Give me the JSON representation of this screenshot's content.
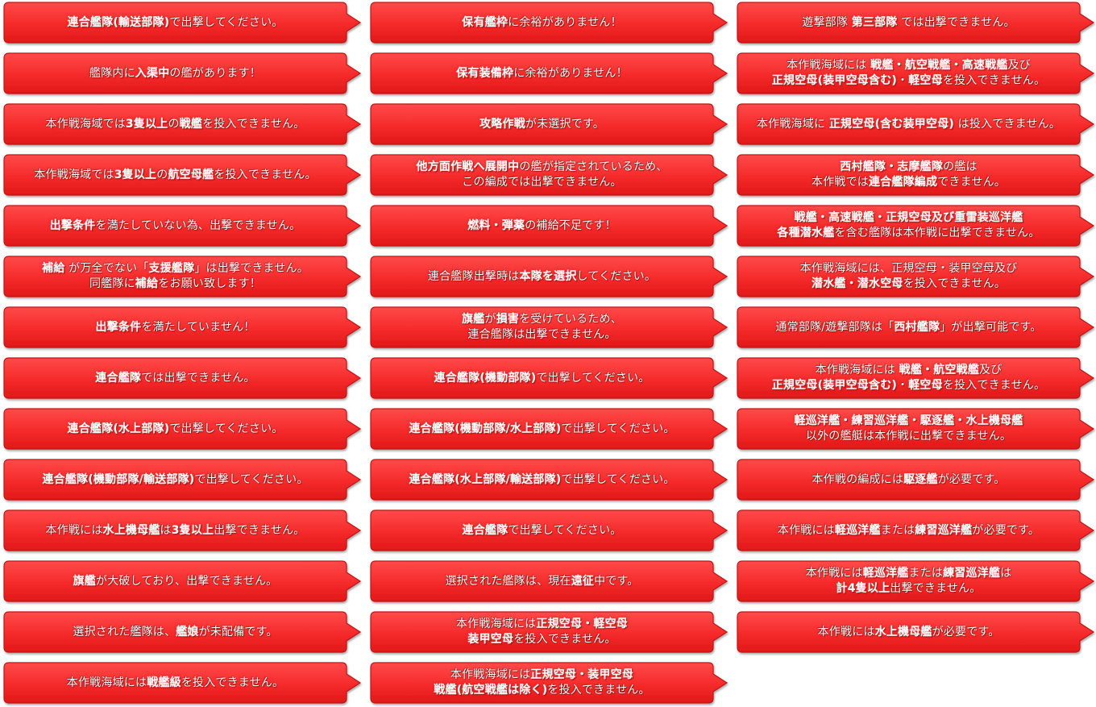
{
  "colors": {
    "balloon_fill": "#ff3b3b",
    "balloon_fill_dark": "#e61717",
    "balloon_border": "#c21414",
    "text": "#ffffff",
    "highlight_glow": "#ff5b5b"
  },
  "columns": [
    {
      "messages": [
        {
          "lines": [
            [
              "連合艦隊(輸送部隊)",
              true
            ],
            [
              "で出撃してください。",
              false
            ]
          ]
        },
        {
          "lines": [
            [
              "艦隊内に",
              false
            ],
            [
              "入渠中",
              true
            ],
            [
              "の艦があります！",
              false
            ]
          ]
        },
        {
          "lines": [
            [
              "本作戦海域では",
              false
            ],
            [
              "3隻以上",
              true
            ],
            [
              "の",
              false
            ],
            [
              "戦艦",
              true
            ],
            [
              "を投入できません。",
              false
            ]
          ]
        },
        {
          "lines": [
            [
              "本作戦海域では",
              false
            ],
            [
              "3隻以上",
              true
            ],
            [
              "の",
              false
            ],
            [
              "航空母艦",
              true
            ],
            [
              "を投入できません。",
              false
            ]
          ]
        },
        {
          "lines": [
            [
              "出撃条件",
              true
            ],
            [
              "を満たしていない為、出撃できません。",
              false
            ]
          ]
        },
        {
          "lines": [
            [
              "補給",
              true
            ],
            [
              " が万全でない「",
              false
            ],
            [
              "支援艦隊",
              true
            ],
            [
              "」は出撃できません。",
              false
            ]
          ],
          "lines2": [
            [
              "同艦隊に",
              false
            ],
            [
              "補給",
              true
            ],
            [
              "をお願い致します！",
              false
            ]
          ]
        },
        {
          "lines": [
            [
              "出撃条件",
              true
            ],
            [
              "を満たしていません！",
              false
            ]
          ]
        },
        {
          "lines": [
            [
              "連合艦隊",
              true
            ],
            [
              "では出撃できません。",
              false
            ]
          ]
        },
        {
          "lines": [
            [
              "連合艦隊(水上部隊)",
              true
            ],
            [
              "で出撃してください。",
              false
            ]
          ]
        },
        {
          "lines": [
            [
              "連合艦隊(機動部隊/輸送部隊)",
              true
            ],
            [
              "で出撃してください。",
              false
            ]
          ]
        },
        {
          "lines": [
            [
              "本作戦には",
              false
            ],
            [
              "水上機母艦",
              true
            ],
            [
              "は",
              false
            ],
            [
              "3隻以上",
              true
            ],
            [
              "出撃できません。",
              false
            ]
          ]
        },
        {
          "lines": [
            [
              "旗艦",
              true
            ],
            [
              "が大破しており、出撃できません。",
              false
            ]
          ]
        },
        {
          "lines": [
            [
              "選択された艦隊は、",
              false
            ],
            [
              "艦娘",
              true
            ],
            [
              "が未配備です。",
              false
            ]
          ]
        },
        {
          "lines": [
            [
              "本作戦海域には",
              false
            ],
            [
              "戦艦級",
              true
            ],
            [
              "を投入できません。",
              false
            ]
          ]
        }
      ]
    },
    {
      "messages": [
        {
          "lines": [
            [
              "保有艦枠",
              true
            ],
            [
              "に余裕がありません！",
              false
            ]
          ]
        },
        {
          "lines": [
            [
              "保有装備枠",
              true
            ],
            [
              "に余裕がありません！",
              false
            ]
          ]
        },
        {
          "lines": [
            [
              "攻略作戦",
              true
            ],
            [
              "が未選択です。",
              false
            ]
          ]
        },
        {
          "lines": [
            [
              "他方面作戦へ展開中",
              true
            ],
            [
              "の艦が指定されているため、",
              false
            ]
          ],
          "lines2": [
            [
              "この編成では出撃できません。",
              false
            ]
          ]
        },
        {
          "lines": [
            [
              "燃料・弾薬",
              true
            ],
            [
              "の補給不足です！",
              false
            ]
          ]
        },
        {
          "lines": [
            [
              "連合艦隊出撃時は",
              false
            ],
            [
              "本隊を選択",
              true
            ],
            [
              "してください。",
              false
            ]
          ]
        },
        {
          "lines": [
            [
              "旗艦",
              true
            ],
            [
              "が",
              false
            ],
            [
              "損害",
              true
            ],
            [
              "を受けているため、",
              false
            ]
          ],
          "lines2": [
            [
              "連合艦隊は出撃できません。",
              false
            ]
          ]
        },
        {
          "lines": [
            [
              "連合艦隊(機動部隊)",
              true
            ],
            [
              "で出撃してください。",
              false
            ]
          ]
        },
        {
          "lines": [
            [
              "連合艦隊(機動部隊/水上部隊)",
              true
            ],
            [
              "で出撃してください。",
              false
            ]
          ]
        },
        {
          "lines": [
            [
              "連合艦隊(水上部隊/輸送部隊)",
              true
            ],
            [
              "で出撃してください。",
              false
            ]
          ]
        },
        {
          "lines": [
            [
              "連合艦隊",
              true
            ],
            [
              "で出撃してください。",
              false
            ]
          ]
        },
        {
          "lines": [
            [
              "選択された艦隊は、現在",
              false
            ],
            [
              "遠征",
              true
            ],
            [
              "中です。",
              false
            ]
          ]
        },
        {
          "lines": [
            [
              "本作戦海域には",
              false
            ],
            [
              "正規空母・軽空母",
              true
            ]
          ],
          "lines2": [
            [
              "装甲空母",
              true
            ],
            [
              "を投入できません。",
              false
            ]
          ]
        },
        {
          "lines": [
            [
              "本作戦海域には",
              false
            ],
            [
              "正規空母・装甲空母",
              true
            ]
          ],
          "lines2": [
            [
              "戦艦(航空戦艦は除く)",
              true
            ],
            [
              "を投入できません。",
              false
            ]
          ]
        }
      ]
    },
    {
      "messages": [
        {
          "lines": [
            [
              "遊撃部隊 ",
              false
            ],
            [
              "第三部隊",
              true
            ],
            [
              " では出撃できません。",
              false
            ]
          ]
        },
        {
          "lines": [
            [
              "本作戦海域には ",
              false
            ],
            [
              "戦艦・航空戦艦・高速戦艦",
              true
            ],
            [
              "及び",
              false
            ]
          ],
          "lines2": [
            [
              "正規空母(装甲空母含む)",
              true
            ],
            [
              "・",
              false
            ],
            [
              "軽空母",
              true
            ],
            [
              "を投入できません。",
              false
            ]
          ]
        },
        {
          "lines": [
            [
              "本作戦海域に ",
              false
            ],
            [
              "正規空母(含む装甲空母)",
              true
            ],
            [
              " は投入できません。",
              false
            ]
          ]
        },
        {
          "lines": [
            [
              "西村艦隊・志摩艦隊",
              true
            ],
            [
              "の艦は",
              false
            ]
          ],
          "lines2": [
            [
              "本作戦では",
              false
            ],
            [
              "連合艦隊編成",
              true
            ],
            [
              "できません。",
              false
            ]
          ]
        },
        {
          "lines": [
            [
              "戦艦・高速戦艦・正規空母及び重雷装巡洋艦",
              true
            ]
          ],
          "lines2": [
            [
              "各種潜水艦",
              true
            ],
            [
              "を含む艦隊は本作戦に出撃できません。",
              false
            ]
          ]
        },
        {
          "lines": [
            [
              "本作戦海域には、正規空母・装甲空母及び",
              false
            ]
          ],
          "lines2": [
            [
              "潜水艦・潜水空母",
              true
            ],
            [
              "を投入できません。",
              false
            ]
          ]
        },
        {
          "lines": [
            [
              "通常部隊/遊撃部隊は「",
              false
            ],
            [
              "西村艦隊",
              true
            ],
            [
              "」が出撃可能です。",
              false
            ]
          ]
        },
        {
          "lines": [
            [
              "本作戦海域には ",
              false
            ],
            [
              "戦艦・航空戦艦",
              true
            ],
            [
              "及び",
              false
            ]
          ],
          "lines2": [
            [
              "正規空母(装甲空母含む)",
              true
            ],
            [
              "・",
              false
            ],
            [
              "軽空母",
              true
            ],
            [
              "を投入できません。",
              false
            ]
          ]
        },
        {
          "lines": [
            [
              "軽巡洋艦・練習巡洋艦・駆逐艦・水上機母艦",
              true
            ]
          ],
          "lines2": [
            [
              "以外の艦艇は本作戦に出撃できません。",
              false
            ]
          ]
        },
        {
          "lines": [
            [
              "本作戦の編成には",
              false
            ],
            [
              "駆逐艦",
              true
            ],
            [
              "が必要です。",
              false
            ]
          ]
        },
        {
          "lines": [
            [
              "本作戦には",
              false
            ],
            [
              "軽巡洋艦",
              true
            ],
            [
              "または",
              false
            ],
            [
              "練習巡洋艦",
              true
            ],
            [
              "が必要です。",
              false
            ]
          ]
        },
        {
          "lines": [
            [
              "本作戦には",
              false
            ],
            [
              "軽巡洋艦",
              true
            ],
            [
              "または",
              false
            ],
            [
              "練習巡洋艦",
              true
            ],
            [
              "は",
              false
            ]
          ],
          "lines2": [
            [
              "計4隻以上",
              true
            ],
            [
              "出撃できません。",
              false
            ]
          ]
        },
        {
          "lines": [
            [
              "本作戦には",
              false
            ],
            [
              "水上機母艦",
              true
            ],
            [
              "が必要です。",
              false
            ]
          ]
        }
      ]
    }
  ]
}
